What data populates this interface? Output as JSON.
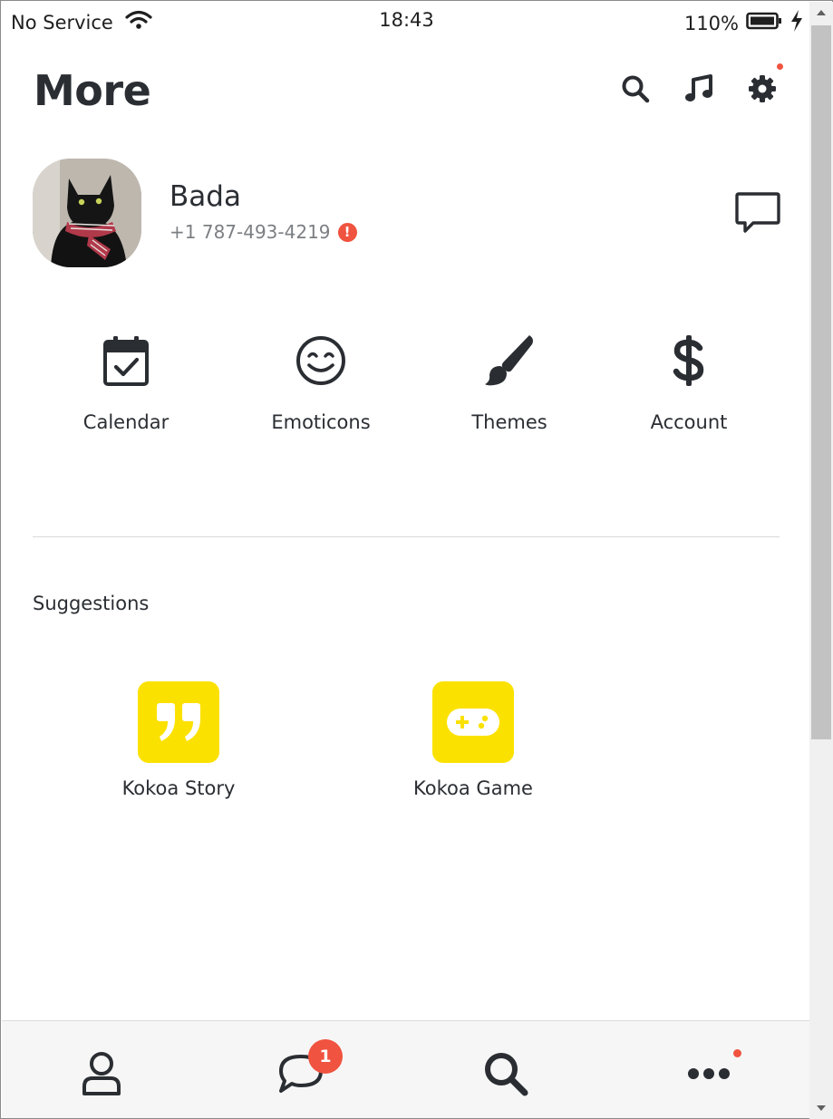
{
  "status_bar": {
    "carrier": "No Service",
    "time": "18:43",
    "battery": "110%"
  },
  "header": {
    "title": "More",
    "icons": [
      "search-icon",
      "music-note-icon",
      "gear-icon"
    ]
  },
  "profile": {
    "name": "Bada",
    "phone": "+1 787-493-4219",
    "warning_glyph": "!"
  },
  "quick_menu": [
    {
      "label": "Calendar",
      "icon": "calendar-check-icon"
    },
    {
      "label": "Emoticons",
      "icon": "smile-icon"
    },
    {
      "label": "Themes",
      "icon": "paintbrush-icon"
    },
    {
      "label": "Account",
      "icon": "dollar-icon"
    }
  ],
  "suggestions": {
    "title": "Suggestions",
    "items": [
      {
        "label": "Kokoa Story",
        "icon": "quote-icon"
      },
      {
        "label": "Kokoa Game",
        "icon": "gamepad-icon"
      }
    ]
  },
  "tab_bar": {
    "tabs": [
      "person-icon",
      "chat-bubble-icon",
      "search-icon",
      "more-dots-icon"
    ],
    "chats_badge": "1"
  },
  "colors": {
    "accent_yellow": "#fbe100",
    "alert_red": "#f0533f",
    "text_dark": "#2a2e33",
    "text_muted": "#7b7f83"
  }
}
